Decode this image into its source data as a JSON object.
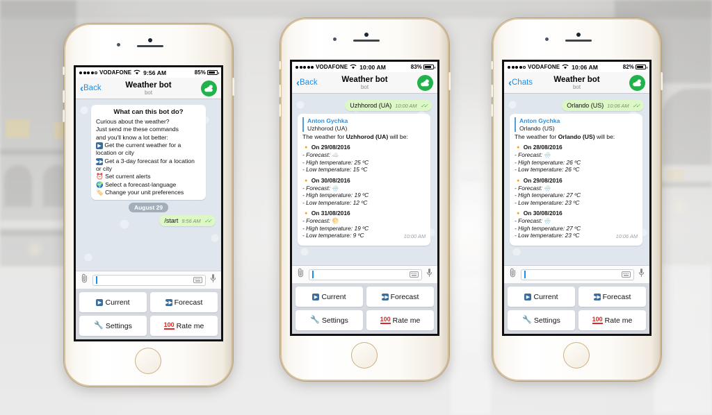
{
  "app": {
    "title": "Weather bot",
    "subtitle": "bot",
    "avatar_icon": "sun-behind-cloud-icon",
    "accent_green": "#22b24c",
    "link_blue": "#1a8fe8",
    "bubble_out_green": "#ddf7c6"
  },
  "keyboard": {
    "buttons": [
      {
        "label": "Current",
        "icon": "play-button-icon"
      },
      {
        "label": "Forecast",
        "icon": "fast-forward-icon"
      },
      {
        "label": "Settings",
        "icon": "wrench-icon"
      },
      {
        "label": "Rate me",
        "icon": "hundred-points-icon"
      }
    ]
  },
  "input_bar": {
    "value": "",
    "placeholder": "",
    "attach_icon": "paperclip-icon",
    "keyboard_icon": "keyboard-icon",
    "mic_icon": "microphone-icon"
  },
  "phones": [
    {
      "id": "phone-1",
      "status": {
        "carrier": "VODAFONE",
        "signal_filled": 4,
        "signal_total": 5,
        "time": "9:56 AM",
        "battery": "85%",
        "battery_level": 85,
        "wifi_icon": "wifi-icon"
      },
      "nav": {
        "back_label": "Back",
        "title": "Weather bot",
        "subtitle": "bot"
      },
      "intro_card": {
        "heading": "What can this bot do?",
        "lines": [
          {
            "emoji": "",
            "text": "Curious about the weather?"
          },
          {
            "emoji": "",
            "text": "Just send me these commands"
          },
          {
            "emoji": "",
            "text": "and you'll know a lot better:"
          },
          {
            "emoji": "▶️",
            "text": "Get the current weather for a location or city"
          },
          {
            "emoji": "⏩",
            "text": "Get a 3-day forecast for a location or city"
          },
          {
            "emoji": "⏰",
            "text": "Set current alerts"
          },
          {
            "emoji": "🌍",
            "text": "Select a forecast-language"
          },
          {
            "emoji": "🏷️",
            "text": "Change your unit preferences"
          }
        ]
      },
      "date_divider": "August 29",
      "outgoing": {
        "text": "/start",
        "time": "9:56 AM",
        "ticks": "✓✓"
      }
    },
    {
      "id": "phone-2",
      "status": {
        "carrier": "VODAFONE",
        "signal_filled": 5,
        "signal_total": 5,
        "time": "10:00 AM",
        "battery": "83%",
        "battery_level": 83,
        "wifi_icon": "wifi-icon"
      },
      "nav": {
        "back_label": "Back",
        "title": "Weather bot",
        "subtitle": "bot"
      },
      "outgoing": {
        "text": "Uzhhorod (UA)",
        "time": "10:00 AM",
        "ticks": "✓✓"
      },
      "forecast_card": {
        "reply_name": "Anton Gychka",
        "reply_text": "Uzhhorod (UA)",
        "headline_prefix": "The weather for ",
        "headline_place": "Uzhhorod (UA)",
        "headline_suffix": " will be:",
        "days": [
          {
            "date": "On 29/08/2016",
            "forecast_icon": "☁️",
            "high": "High temperature: 25 ºC",
            "low": "Low temperature: 15 ºC"
          },
          {
            "date": "On 30/08/2016",
            "forecast_icon": "🌧️",
            "high": "High temperature: 19 ºC",
            "low": "Low temperature: 12 ºC"
          },
          {
            "date": "On 31/08/2016",
            "forecast_icon": "🌕",
            "high": "High temperature: 19 ºC",
            "low": "Low temperature: 9 ºC"
          }
        ],
        "labels": {
          "forecast": "- Forecast:",
          "high_prefix": "- ",
          "low_prefix": "- "
        },
        "time": "10:00 AM"
      }
    },
    {
      "id": "phone-3",
      "status": {
        "carrier": "VODAFONE",
        "signal_filled": 4,
        "signal_total": 5,
        "time": "10:06 AM",
        "battery": "82%",
        "battery_level": 82,
        "wifi_icon": "wifi-icon"
      },
      "nav": {
        "back_label": "Chats",
        "title": "Weather bot",
        "subtitle": "bot"
      },
      "outgoing": {
        "text": "Orlando (US)",
        "time": "10:06 AM",
        "ticks": "✓✓"
      },
      "forecast_card": {
        "reply_name": "Anton Gychka",
        "reply_text": "Orlando (US)",
        "headline_prefix": "The weather for ",
        "headline_place": "Orlando (US)",
        "headline_suffix": " will be:",
        "days": [
          {
            "date": "On 28/08/2016",
            "forecast_icon": "🌧️",
            "high": "High temperature: 26 ºC",
            "low": "Low temperature: 26 ºC"
          },
          {
            "date": "On 29/08/2016",
            "forecast_icon": "🌧️",
            "high": "High temperature: 27 ºC",
            "low": "Low temperature: 23 ºC"
          },
          {
            "date": "On 30/08/2016",
            "forecast_icon": "🌧️",
            "high": "High temperature: 27 ºC",
            "low": "Low temperature: 23 ºC"
          }
        ],
        "labels": {
          "forecast": "- Forecast:",
          "high_prefix": "- ",
          "low_prefix": "- "
        },
        "time": "10:06 AM"
      }
    }
  ]
}
